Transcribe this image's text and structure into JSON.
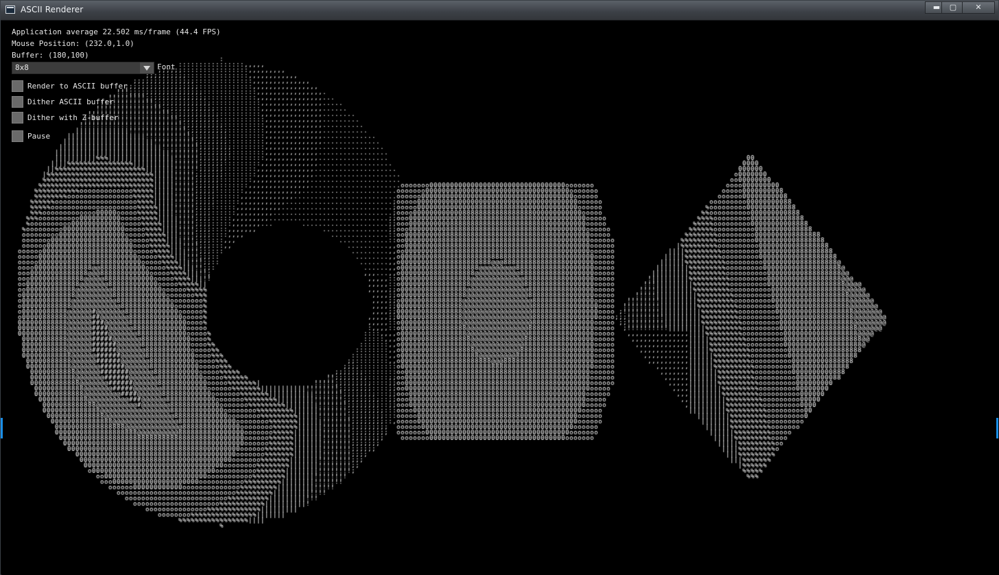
{
  "window": {
    "title": "ASCII Renderer",
    "controls": {
      "minimize": "▬",
      "maximize": "▢",
      "close": "✕"
    }
  },
  "stats": {
    "fps_line": "Application average 22.502 ms/frame (44.4 FPS)",
    "mouse_line": "Mouse Position: (232.0,1.0)",
    "buffer_line": "Buffer: (180,100)"
  },
  "font_select": {
    "value": "8x8",
    "label": "Font"
  },
  "options": [
    {
      "label": "Render to ASCII buffer",
      "checked": false
    },
    {
      "label": "Dither ASCII buffer",
      "checked": false
    },
    {
      "label": "Dither with Z-buffer",
      "checked": false
    },
    {
      "label": "Pause",
      "checked": false
    }
  ],
  "colors": {
    "background": "#000000",
    "glyph": "#ffffff",
    "title_bar": "#3c4046",
    "accent": "#1a8fe8"
  },
  "ascii_ramp": " .,:;!|%o08@#"
}
